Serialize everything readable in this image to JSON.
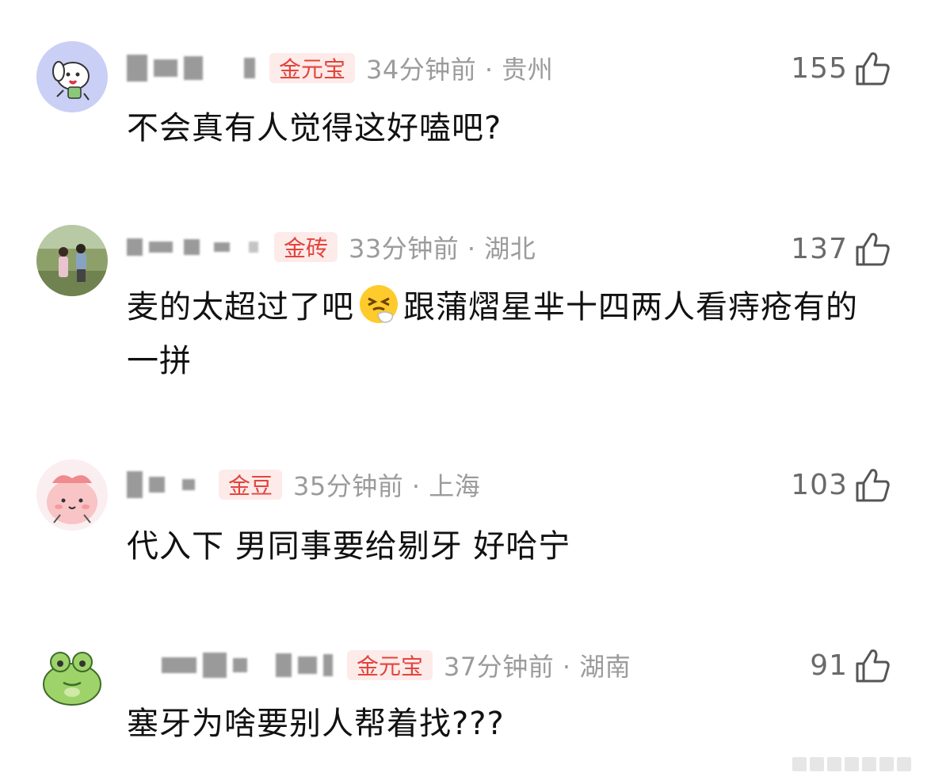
{
  "comments": [
    {
      "badge": "金元宝",
      "time": "34分钟前",
      "location": "贵州",
      "meta": "34分钟前 · 贵州",
      "likes": "155",
      "text": "不会真有人觉得这好嗑吧?",
      "avatar_icon": "cartoon-dog-avatar"
    },
    {
      "badge": "金砖",
      "time": "33分钟前",
      "location": "湖北",
      "meta": "33分钟前 · 湖北",
      "likes": "137",
      "text_before": "麦的太超过了吧",
      "emoji": "sneezing-face-emoji",
      "text_after": "跟蒲熠星芈十四两人看痔疮有的一拼",
      "avatar_icon": "couple-photo-avatar"
    },
    {
      "badge": "金豆",
      "time": "35分钟前",
      "location": "上海",
      "meta": "35分钟前 · 上海",
      "likes": "103",
      "text": "代入下 男同事要给剔牙 好哈宁",
      "avatar_icon": "pink-blob-avatar"
    },
    {
      "badge": "金元宝",
      "time": "37分钟前",
      "location": "湖南",
      "meta": "37分钟前 · 湖南",
      "likes": "91",
      "text": "塞牙为啥要别人帮着找???",
      "avatar_icon": "green-frog-avatar"
    }
  ],
  "colors": {
    "badge_bg": "#fdebea",
    "badge_text": "#e2453c",
    "meta_text": "#9b9b9b",
    "likes_text": "#6a6a6a"
  }
}
